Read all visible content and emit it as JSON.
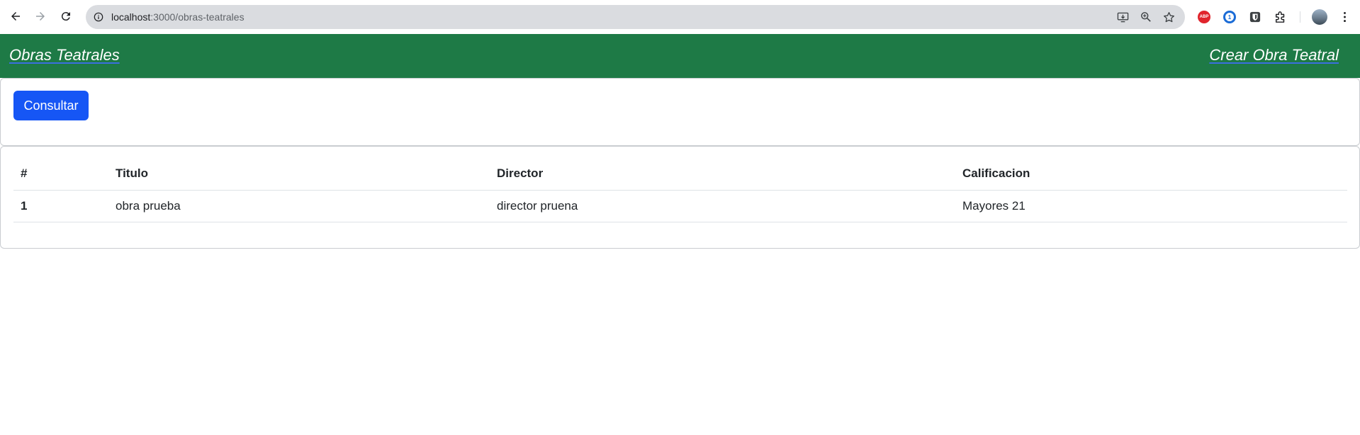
{
  "browser": {
    "url_host": "localhost",
    "url_path": ":3000/obras-teatrales",
    "icons": [
      "back-arrow-icon",
      "forward-arrow-icon",
      "reload-icon",
      "site-info-icon",
      "install-app-icon",
      "zoom-icon",
      "bookmark-star-icon",
      "adblock-plus-icon",
      "1password-icon",
      "bitwarden-icon",
      "extensions-puzzle-icon",
      "profile-avatar",
      "menu-kebab-icon"
    ],
    "abp_label": "ABP"
  },
  "navbar": {
    "brand": "Obras Teatrales",
    "create_link": "Crear Obra Teatral",
    "color": "#1e7a46"
  },
  "actions": {
    "consultar_label": "Consultar",
    "button_color": "#1656f5"
  },
  "table": {
    "headers": [
      "#",
      "Titulo",
      "Director",
      "Calificacion"
    ],
    "rows": [
      [
        "1",
        "obra prueba",
        "director pruena",
        "Mayores 21"
      ]
    ]
  }
}
